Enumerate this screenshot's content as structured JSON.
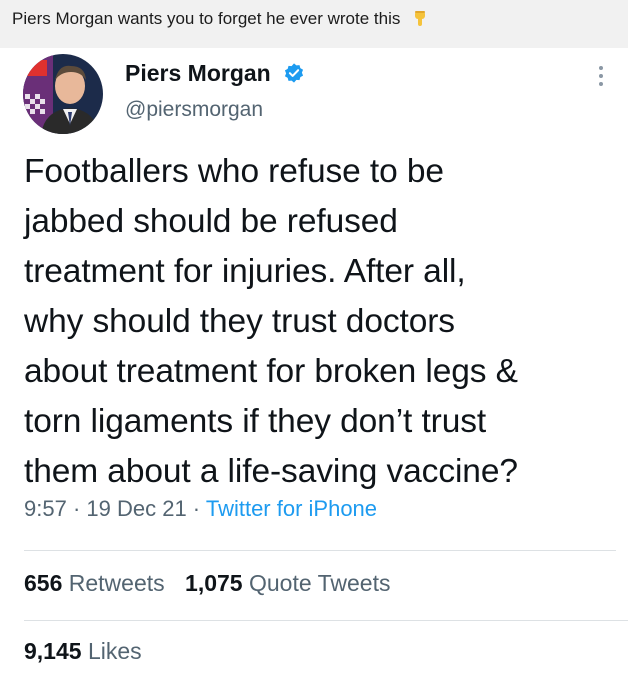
{
  "caption": {
    "text": "Piers Morgan wants you to forget he ever wrote this",
    "emoji": "pointing-down-emoji"
  },
  "tweet": {
    "author_name": "Piers Morgan",
    "handle": "@piersmorgan",
    "verified_icon": "verified-badge-icon",
    "more_icon": "more-options-icon",
    "text_lines": [
      "Footballers who refuse to be",
      "jabbed should be refused",
      "treatment for injuries. After all,",
      "why should they trust doctors",
      "about treatment for broken legs &",
      "torn ligaments if they don’t trust",
      "them about a life-saving vaccine?"
    ],
    "time": "9:57",
    "date": "19 Dec 21",
    "source": "Twitter for iPhone",
    "separator": " · ",
    "retweets_count": "656",
    "retweets_label": "Retweets",
    "quotes_count": "1,075",
    "quotes_label": "Quote Tweets",
    "likes_count": "9,145",
    "likes_label": "Likes"
  },
  "colors": {
    "link": "#1d9bf0",
    "secondary_text": "#536471",
    "primary_text": "#0f1419",
    "caption_background": "#f1f1f1"
  }
}
